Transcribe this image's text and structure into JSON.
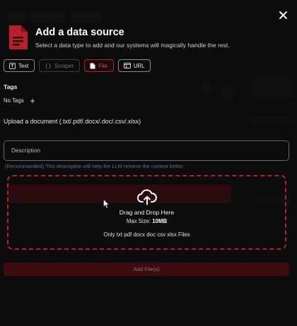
{
  "dialog": {
    "title": "Add a data source",
    "subtitle": "Select a data type to add and our systems will magically handle the rest.",
    "close_icon": "close-icon",
    "header_icon": "document-icon"
  },
  "tabs": [
    {
      "label": "Text",
      "icon": "text-icon",
      "state": "normal"
    },
    {
      "label": "Scraper",
      "icon": "braces-icon",
      "state": "disabled"
    },
    {
      "label": "File",
      "icon": "file-icon",
      "state": "selected"
    },
    {
      "label": "URL",
      "icon": "url-icon",
      "state": "normal"
    }
  ],
  "tags": {
    "label": "Tags",
    "empty_text": "No Tags",
    "add_symbol": "+"
  },
  "upload": {
    "label": "Upload a document (.txt/.pdf/.docx/.doc/.csv/.xlsx)"
  },
  "description": {
    "placeholder": "Description",
    "value": "",
    "hint": "(Recommanded) This description will help the LLM retrieve the context better."
  },
  "dropzone": {
    "title": "Drag and Drop Here",
    "max_label": "Max Size: ",
    "max_value": "10MB",
    "types": "Only txt pdf docx doc csv xlsx Files",
    "icon": "cloud-upload-icon"
  },
  "submit": {
    "label": "Add File(s)"
  },
  "colors": {
    "accent": "#b5202c",
    "background": "#121212",
    "hint": "#5d6f8f"
  }
}
